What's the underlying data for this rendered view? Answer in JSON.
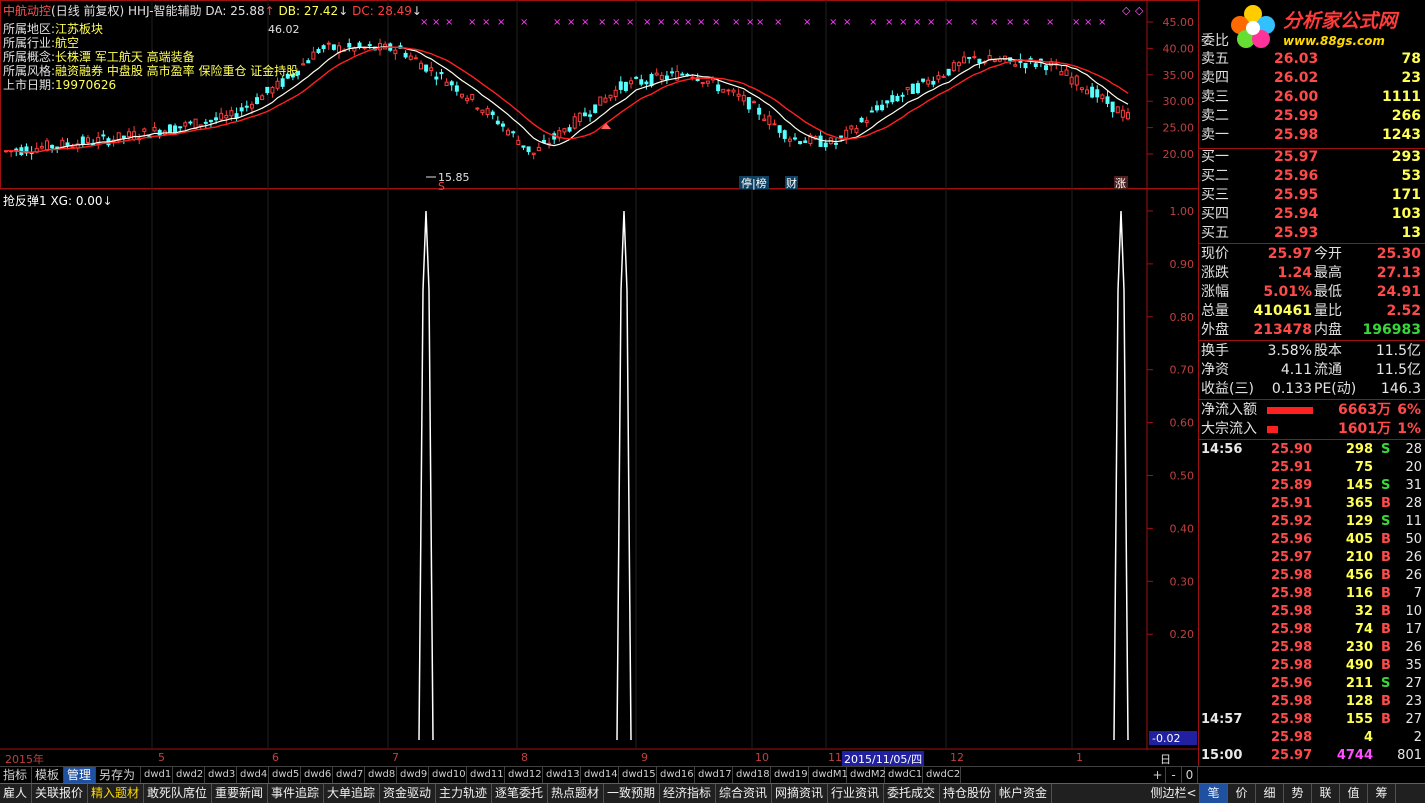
{
  "title": {
    "stock": "中航动控",
    "mode": "(日线 前复权)",
    "indicator": "HHJ-智能辅助",
    "da": "DA: 25.88",
    "db": "DB: 27.42",
    "dc": "DC: 28.49"
  },
  "info": {
    "region_label": "所属地区:",
    "region": "江苏板块",
    "industry_label": "所属行业:",
    "industry": "航空",
    "concept_label": "所属概念:",
    "concept": "长株潭 军工航天 高端装备",
    "style_label": "所属风格:",
    "style": "融资融券 中盘股 高市盈率 保险重仓 证金持股",
    "listing_label": "上市日期:",
    "listing": "19970626"
  },
  "price_axis": [
    "45.00",
    "40.00",
    "35.00",
    "30.00",
    "25.00",
    "20.00"
  ],
  "annotations": {
    "low": "15.85",
    "high": "46.02",
    "s_mark": "S",
    "board": "停|榜",
    "fin": "财",
    "rise": "涨"
  },
  "indicator_panel": {
    "title": "抢反弹1  XG: 0.00",
    "axis": [
      "1.00",
      "0.90",
      "0.80",
      "0.70",
      "0.60",
      "0.50",
      "0.40",
      "0.30",
      "0.20"
    ],
    "bottom_value": "-0.02"
  },
  "time_axis": {
    "labels": [
      "2015年",
      "5",
      "6",
      "7",
      "8",
      "9",
      "10",
      "11",
      "12",
      "1"
    ],
    "cursor_date": "2015/11/05/四",
    "period": "日线"
  },
  "order_book": {
    "header": "委比",
    "asks": [
      {
        "label": "卖五",
        "price": "26.03",
        "vol": "78"
      },
      {
        "label": "卖四",
        "price": "26.02",
        "vol": "23"
      },
      {
        "label": "卖三",
        "price": "26.00",
        "vol": "1111"
      },
      {
        "label": "卖二",
        "price": "25.99",
        "vol": "266"
      },
      {
        "label": "卖一",
        "price": "25.98",
        "vol": "1243"
      }
    ],
    "bids": [
      {
        "label": "买一",
        "price": "25.97",
        "vol": "293"
      },
      {
        "label": "买二",
        "price": "25.96",
        "vol": "53"
      },
      {
        "label": "买三",
        "price": "25.95",
        "vol": "171"
      },
      {
        "label": "买四",
        "price": "25.94",
        "vol": "103"
      },
      {
        "label": "买五",
        "price": "25.93",
        "vol": "13"
      }
    ]
  },
  "quote": {
    "rows": [
      {
        "l1": "现价",
        "v1": "25.97",
        "l2": "今开",
        "v2": "25.30"
      },
      {
        "l1": "涨跌",
        "v1": "1.24",
        "l2": "最高",
        "v2": "27.13"
      },
      {
        "l1": "涨幅",
        "v1": "5.01%",
        "l2": "最低",
        "v2": "24.91"
      },
      {
        "l1": "总量",
        "v1": "410461",
        "l2": "量比",
        "v2": "2.52"
      },
      {
        "l1": "外盘",
        "v1": "213478",
        "l2": "内盘",
        "v2": "196983"
      }
    ],
    "rows2": [
      {
        "l1": "换手",
        "v1": "3.58%",
        "l2": "股本",
        "v2": "11.5亿"
      },
      {
        "l1": "净资",
        "v1": "4.11",
        "l2": "流通",
        "v2": "11.5亿"
      },
      {
        "l1": "收益(三)",
        "v1": "0.133",
        "l2": "PE(动)",
        "v2": "146.3"
      }
    ],
    "flow": [
      {
        "label": "净流入额",
        "value": "6663万",
        "pct": "6%",
        "bar": 0.85
      },
      {
        "label": "大宗流入",
        "value": "1601万",
        "pct": "1%",
        "bar": 0.2
      }
    ]
  },
  "ticks": [
    {
      "time": "14:56",
      "price": "25.90",
      "vol": "298",
      "side": "S",
      "n": "28"
    },
    {
      "time": "",
      "price": "25.91",
      "vol": "75",
      "side": "",
      "n": "20"
    },
    {
      "time": "",
      "price": "25.89",
      "vol": "145",
      "side": "S",
      "n": "31"
    },
    {
      "time": "",
      "price": "25.91",
      "vol": "365",
      "side": "B",
      "n": "28"
    },
    {
      "time": "",
      "price": "25.92",
      "vol": "129",
      "side": "S",
      "n": "11"
    },
    {
      "time": "",
      "price": "25.96",
      "vol": "405",
      "side": "B",
      "n": "50"
    },
    {
      "time": "",
      "price": "25.97",
      "vol": "210",
      "side": "B",
      "n": "26"
    },
    {
      "time": "",
      "price": "25.98",
      "vol": "456",
      "side": "B",
      "n": "26"
    },
    {
      "time": "",
      "price": "25.98",
      "vol": "116",
      "side": "B",
      "n": "7"
    },
    {
      "time": "",
      "price": "25.98",
      "vol": "32",
      "side": "B",
      "n": "10"
    },
    {
      "time": "",
      "price": "25.98",
      "vol": "74",
      "side": "B",
      "n": "17"
    },
    {
      "time": "",
      "price": "25.98",
      "vol": "230",
      "side": "B",
      "n": "26"
    },
    {
      "time": "",
      "price": "25.98",
      "vol": "490",
      "side": "B",
      "n": "35"
    },
    {
      "time": "",
      "price": "25.96",
      "vol": "211",
      "side": "S",
      "n": "27"
    },
    {
      "time": "",
      "price": "25.98",
      "vol": "128",
      "side": "B",
      "n": "23"
    },
    {
      "time": "14:57",
      "price": "25.98",
      "vol": "155",
      "side": "B",
      "n": "27"
    },
    {
      "time": "",
      "price": "25.98",
      "vol": "4",
      "side": "",
      "n": "2"
    },
    {
      "time": "15:00",
      "price": "25.97",
      "vol": "4744",
      "side": "",
      "n": "801"
    }
  ],
  "tabs1": [
    "指标",
    "模板",
    "管理",
    "另存为",
    "dwd1",
    "dwd2",
    "dwd3",
    "dwd4",
    "dwd5",
    "dwd6",
    "dwd7",
    "dwd8",
    "dwd9",
    "dwd10",
    "dwd11",
    "dwd12",
    "dwd13",
    "dwd14",
    "dwd15",
    "dwd16",
    "dwd17",
    "dwd18",
    "dwd19",
    "dwdM1",
    "dwdM2",
    "dwdC1",
    "dwdC2"
  ],
  "tabs1_right": [
    "+",
    "-",
    "0"
  ],
  "tabs2": [
    "雇人",
    "关联报价",
    "精入题材",
    "敢死队席位",
    "重要新闻",
    "事件追踪",
    "大单追踪",
    "资金驱动",
    "主力轨迹",
    "逐笔委托",
    "热点题材",
    "一致预期",
    "经济指标",
    "综合资讯",
    "网摘资讯",
    "行业资讯",
    "委托成交",
    "持仓股份",
    "帐户资金"
  ],
  "tabs2_right": [
    "侧边栏<",
    "笔",
    "价",
    "细",
    "势",
    "联",
    "值",
    "筹"
  ],
  "brand": {
    "name": "分析家公式网",
    "url": "www.88gs.com"
  }
}
